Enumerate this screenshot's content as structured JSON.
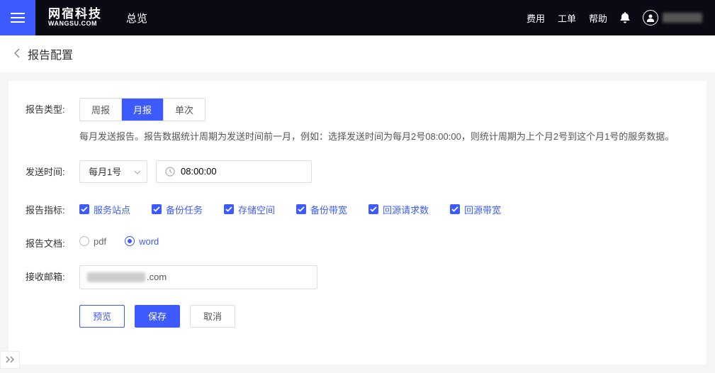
{
  "header": {
    "logo_cn": "网宿科技",
    "logo_en": "WANGSU.COM",
    "overview": "总览",
    "links": {
      "billing": "费用",
      "ticket": "工单",
      "help": "帮助"
    }
  },
  "subheader": {
    "title": "报告配置"
  },
  "form": {
    "report_type": {
      "label": "报告类型:",
      "options": {
        "weekly": "周报",
        "monthly": "月报",
        "once": "单次"
      },
      "hint": "每月发送报告。报告数据统计周期为发送时间前一月，例如：选择发送时间为每月2号08:00:00，则统计周期为上个月2号到这个月1号的服务数据。"
    },
    "send_time": {
      "label": "发送时间:",
      "day_selected": "每月1号",
      "time_value": "08:00:00"
    },
    "metrics": {
      "label": "报告指标:",
      "items": [
        "服务站点",
        "备份任务",
        "存储空间",
        "备份带宽",
        "回源请求数",
        "回源带宽"
      ]
    },
    "doc_format": {
      "label": "报告文档:",
      "pdf": "pdf",
      "word": "word"
    },
    "email": {
      "label": "接收邮箱:",
      "suffix": ".com"
    },
    "buttons": {
      "preview": "预览",
      "save": "保存",
      "cancel": "取消"
    }
  }
}
